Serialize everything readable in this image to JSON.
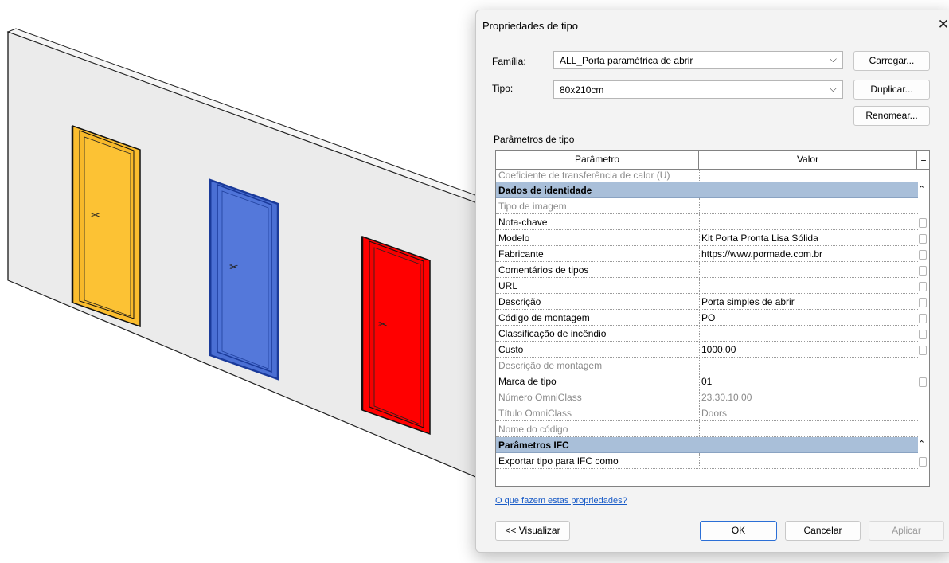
{
  "dialog": {
    "title": "Propriedades de tipo",
    "close_glyph": "✕",
    "familia_label": "Família:",
    "familia_value": "ALL_Porta paramétrica de abrir",
    "tipo_label": "Tipo:",
    "tipo_value": "80x210cm",
    "carregar": "Carregar...",
    "duplicar": "Duplicar...",
    "renomear": "Renomear...",
    "params_label": "Parâmetros de tipo",
    "col_param": "Parâmetro",
    "col_valor": "Valor",
    "col_eq": "=",
    "rows": [
      {
        "p": "Coeficiente de transferência de calor (U)",
        "v": "",
        "kind": "partial"
      },
      {
        "p": "Dados de identidade",
        "v": "",
        "kind": "group"
      },
      {
        "p": "Tipo de imagem",
        "v": "",
        "kind": "dim"
      },
      {
        "p": "Nota-chave",
        "v": "",
        "kind": "normal"
      },
      {
        "p": "Modelo",
        "v": "Kit Porta Pronta Lisa Sólida",
        "kind": "normal"
      },
      {
        "p": "Fabricante",
        "v": "https://www.pormade.com.br",
        "kind": "normal"
      },
      {
        "p": "Comentários de tipos",
        "v": "",
        "kind": "normal"
      },
      {
        "p": "URL",
        "v": "",
        "kind": "normal"
      },
      {
        "p": "Descrição",
        "v": "Porta simples de abrir",
        "kind": "normal"
      },
      {
        "p": "Código de montagem",
        "v": "PO",
        "kind": "normal"
      },
      {
        "p": "Classificação de incêndio",
        "v": "",
        "kind": "normal"
      },
      {
        "p": "Custo",
        "v": "1000.00",
        "kind": "normal"
      },
      {
        "p": "Descrição de montagem",
        "v": "",
        "kind": "dim"
      },
      {
        "p": "Marca de tipo",
        "v": "01",
        "kind": "normal"
      },
      {
        "p": "Número OmniClass",
        "v": "23.30.10.00",
        "kind": "dim"
      },
      {
        "p": "Título OmniClass",
        "v": "Doors",
        "kind": "dim"
      },
      {
        "p": "Nome do código",
        "v": "",
        "kind": "dim"
      },
      {
        "p": "Parâmetros IFC",
        "v": "",
        "kind": "group"
      },
      {
        "p": "Exportar tipo para IFC como",
        "v": "",
        "kind": "normal"
      }
    ],
    "help_link": "O que fazem estas propriedades?",
    "visualizar": "<< Visualizar",
    "ok": "OK",
    "cancelar": "Cancelar",
    "aplicar": "Aplicar"
  },
  "scene": {
    "door_colors": [
      "#fbbd2e",
      "#4a6fd4",
      "#ff0000"
    ],
    "wall_color": "#ebebeb"
  }
}
